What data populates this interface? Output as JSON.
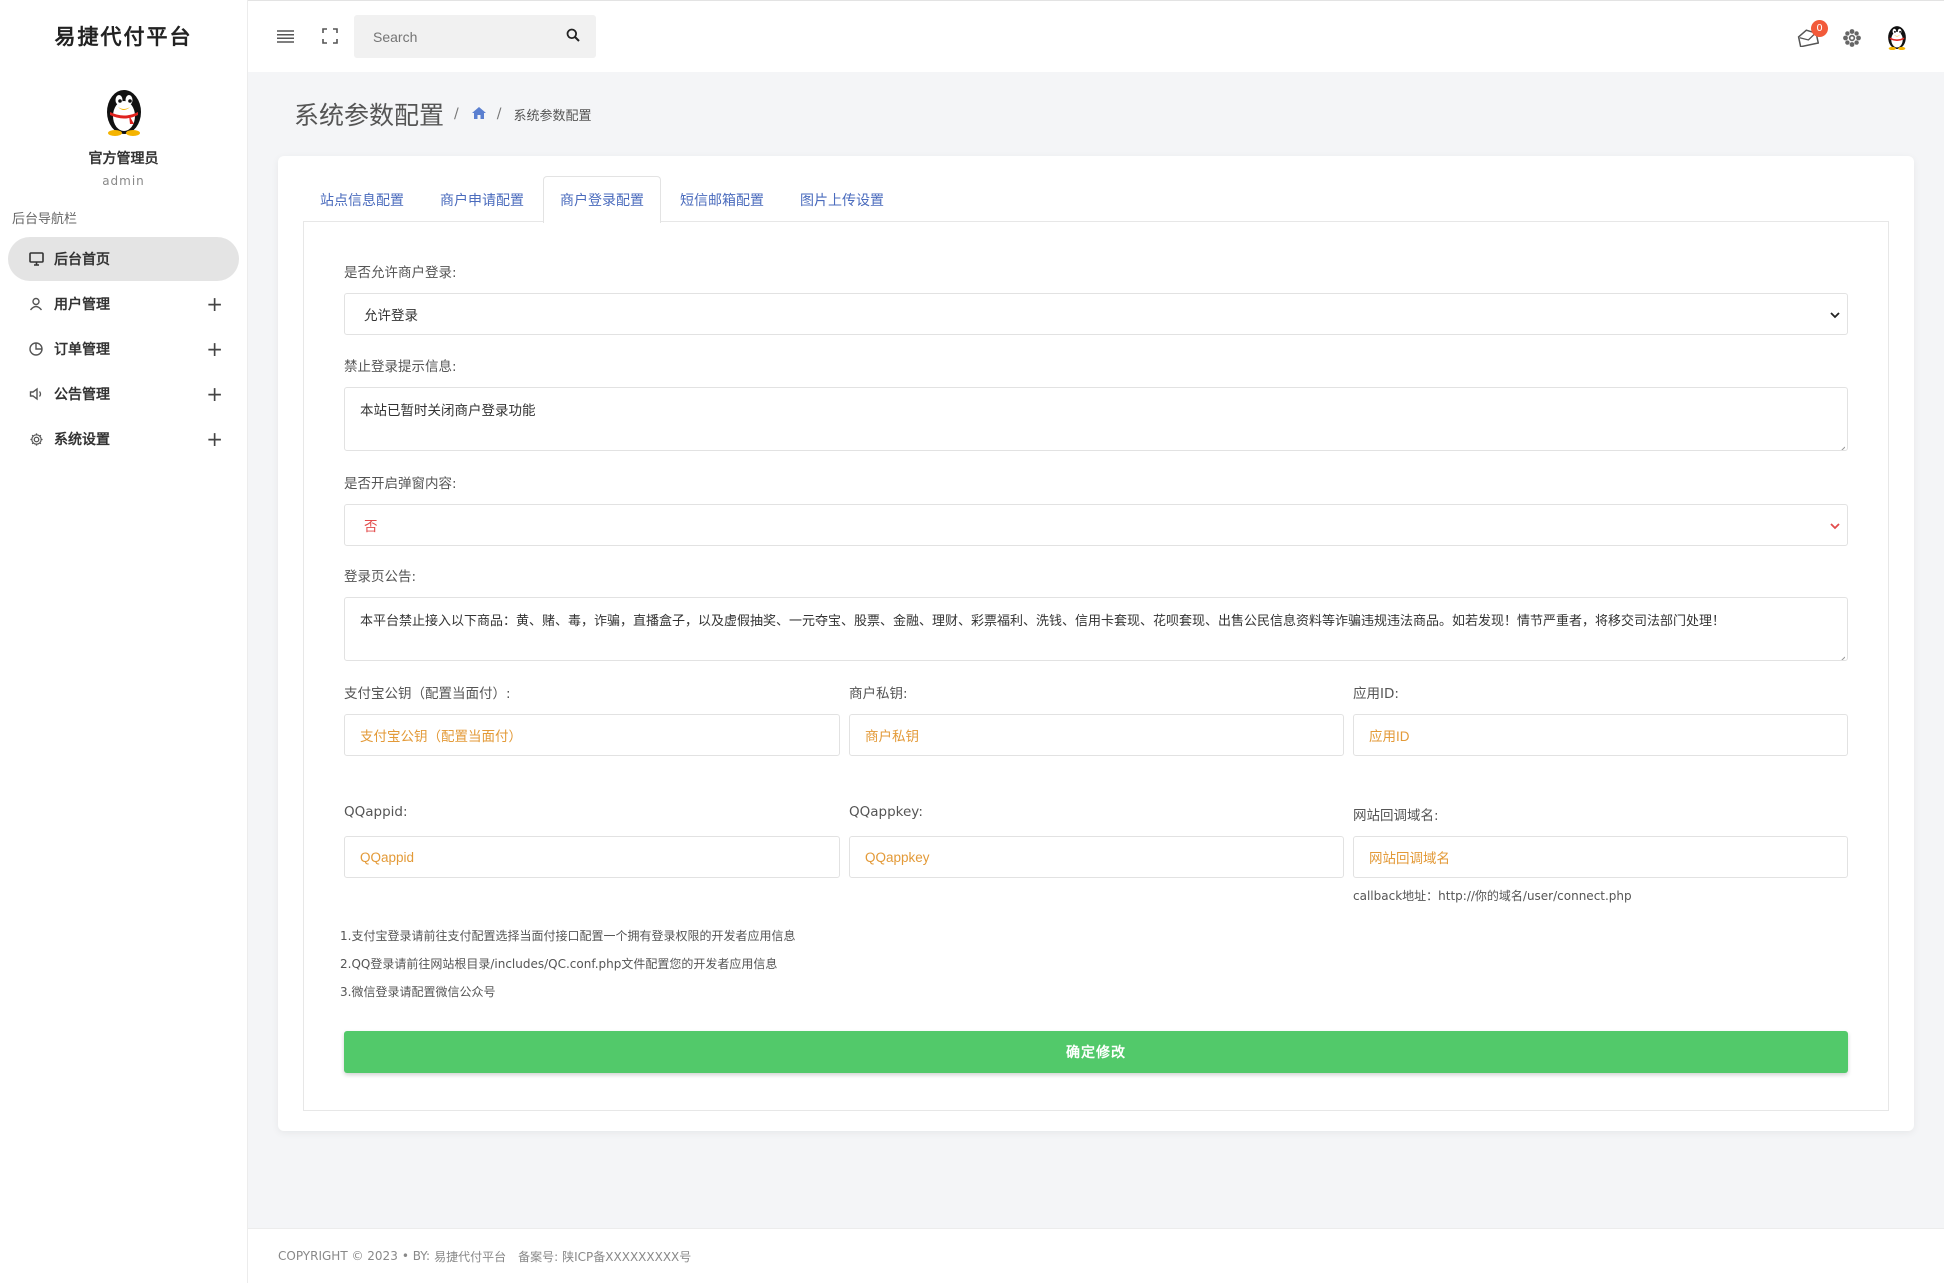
{
  "app": {
    "brand": "易捷代付平台"
  },
  "profile": {
    "name": "官方管理员",
    "role": "admin"
  },
  "sidebar": {
    "heading": "后台导航栏",
    "items": [
      {
        "label": "后台首页",
        "icon": "monitor-icon",
        "active": true
      },
      {
        "label": "用户管理",
        "icon": "user-icon",
        "expand": "+"
      },
      {
        "label": "订单管理",
        "icon": "pie-chart-icon",
        "expand": "+"
      },
      {
        "label": "公告管理",
        "icon": "megaphone-icon",
        "expand": "+"
      },
      {
        "label": "系统设置",
        "icon": "gear-icon",
        "expand": "+"
      }
    ]
  },
  "topbar": {
    "search_placeholder": "Search",
    "notification_count": "0"
  },
  "page": {
    "title": "系统参数配置",
    "breadcrumb_sep": "/",
    "breadcrumb_current": "系统参数配置"
  },
  "tabs": [
    {
      "label": "站点信息配置"
    },
    {
      "label": "商户申请配置"
    },
    {
      "label": "商户登录配置",
      "active": true
    },
    {
      "label": "短信邮箱配置"
    },
    {
      "label": "图片上传设置"
    }
  ],
  "form": {
    "allow_login": {
      "label": "是否允许商户登录:",
      "value": "允许登录"
    },
    "ban_message": {
      "label": "禁止登录提示信息:",
      "value": "本站已暂时关闭商户登录功能"
    },
    "popup": {
      "label": "是否开启弹窗内容:",
      "value": "否"
    },
    "login_notice": {
      "label": "登录页公告:",
      "value": "本平台禁止接入以下商品：黄、赌、毒，诈骗，直播盒子，以及虚假抽奖、一元夺宝、股票、金融、理财、彩票福利、洗钱、信用卡套现、花呗套现、出售公民信息资料等诈骗违规违法商品。如若发现！情节严重者，将移交司法部门处理！"
    },
    "alipay_key": {
      "label": "支付宝公钥（配置当面付）:",
      "placeholder": "支付宝公钥（配置当面付）"
    },
    "merchant_key": {
      "label": "商户私钥:",
      "placeholder": "商户私钥"
    },
    "app_id": {
      "label": "应用ID:",
      "placeholder": "应用ID"
    },
    "qq_appid": {
      "label": "QQappid:",
      "placeholder": "QQappid"
    },
    "qq_appkey": {
      "label": "QQappkey:",
      "placeholder": "QQappkey"
    },
    "callback_domain": {
      "label": "网站回调域名:",
      "placeholder": "网站回调域名",
      "hint": "callback地址：http://你的域名/user/connect.php"
    },
    "notes": [
      "1.支付宝登录请前往支付配置选择当面付接口配置一个拥有登录权限的开发者应用信息",
      "2.QQ登录请前往网站根目录/includes/QC.conf.php文件配置您的开发者应用信息",
      "3.微信登录请配置微信公众号"
    ],
    "submit_label": "确定修改"
  },
  "footer": {
    "copyright": "COPYRIGHT © 2023",
    "by_label": "• BY:",
    "by_name": "易捷代付平台",
    "icp_label": "备案号:",
    "icp_value": "陕ICP备XXXXXXXXX号"
  },
  "colors": {
    "accent_link": "#4a6bbd",
    "submit_green": "#52c96a",
    "placeholder_orange": "#e39a38",
    "badge_red": "#f25a3a",
    "select_red": "#e24b4b"
  }
}
